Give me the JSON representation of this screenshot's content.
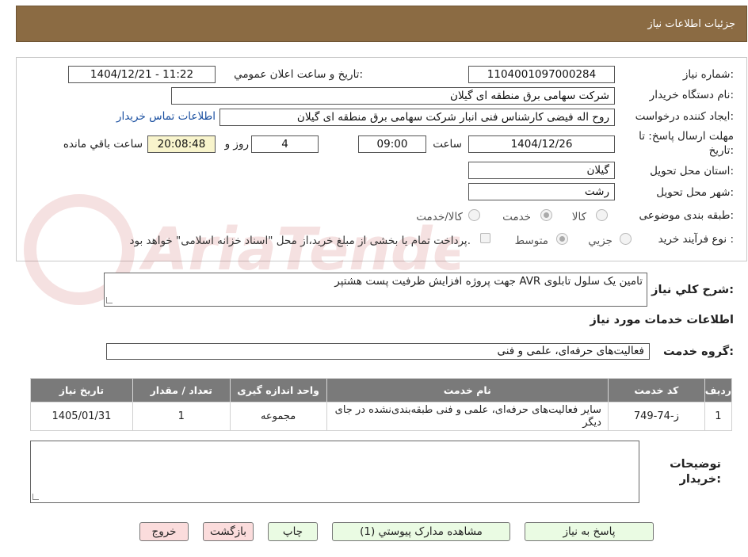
{
  "header": {
    "title": "جزئیات اطلاعات نیاز"
  },
  "form": {
    "need_number": {
      "label": "شماره نیاز:",
      "value": "1104001097000284"
    },
    "announce_datetime": {
      "label": "تاریخ و ساعت اعلان عمومي:",
      "value": "1404/12/21 - 11:22"
    },
    "buyer_org": {
      "label": "نام دستگاه خريدار:",
      "value": "شرکت سهامی برق منطقه ای گیلان"
    },
    "requester": {
      "label": "ايجاد کننده درخواست:",
      "value": "روح اله فیضی کارشناس فنی انبار شرکت سهامی برق منطقه ای گیلان"
    },
    "buyer_contact_link": "اطلاعات تماس خريدار",
    "deadline": {
      "label_line1": "مهلت ارسال پاسخ: تا",
      "label_line2": "تاريخ:",
      "date": "1404/12/26",
      "time_label": "ساعت",
      "time": "09:00",
      "days": "4",
      "days_label": "روز و",
      "remaining": "20:08:48",
      "remaining_label": "ساعت باقي مانده"
    },
    "province": {
      "label": "استان محل تحويل:",
      "value": "گیلان"
    },
    "city": {
      "label": "شهر محل تحويل:",
      "value": "رشت"
    },
    "category": {
      "label": "طبقه بندی موضوعی:",
      "options": [
        {
          "label": "کالا",
          "checked": false
        },
        {
          "label": "خدمت",
          "checked": true
        },
        {
          "label": "کالا/خدمت",
          "checked": false
        }
      ]
    },
    "purchase_type": {
      "label": "نوع فرآيند خريد :",
      "options": [
        {
          "label": "جزيي",
          "checked": false
        },
        {
          "label": "متوسط",
          "checked": true
        }
      ],
      "payment_note": "پرداخت تمام یا بخشی از مبلغ خرید،از محل \"اسناد خزانه اسلامی\" خواهد بود."
    }
  },
  "description": {
    "label": "شرح کلي نياز:",
    "value": "تامین یک سلول تابلوی AVR  جهت پروژه افزایش ظرفیت پست هشتپر"
  },
  "services_section": {
    "title": "اطلاعات خدمات مورد نياز"
  },
  "service_group": {
    "label": "گروه خدمت:",
    "value": "فعالیت‌های حرفه‌ای، علمی و فنی"
  },
  "table": {
    "headers": [
      "رديف",
      "کد خدمت",
      "نام خدمت",
      "واحد اندازه گیری",
      "تعداد / مقدار",
      "تاريخ نياز"
    ],
    "rows": [
      [
        "1",
        "ز-74-749",
        "سایر فعالیت‌های حرفه‌ای، علمی و فنی طبقه‌بندی‌نشده در جای دیگر",
        "مجموعه",
        "1",
        "1405/01/31"
      ]
    ]
  },
  "buyer_notes": {
    "label_line1": "توضيحات",
    "label_line2": "خريدار:",
    "value": ""
  },
  "buttons": {
    "respond": "پاسخ به نياز",
    "attachments": "مشاهده مدارک پيوستي (1)",
    "print": "چاپ",
    "back": "بازگشت",
    "exit": "خروج"
  },
  "colors": {
    "header_bg": "#8b6b43",
    "table_header_bg": "#7a7a7a",
    "button_green": "#eafbe3",
    "button_pink": "#fbdcdc",
    "link": "#1a4fa0"
  },
  "watermark": {
    "text": "AriaTender.neT"
  }
}
